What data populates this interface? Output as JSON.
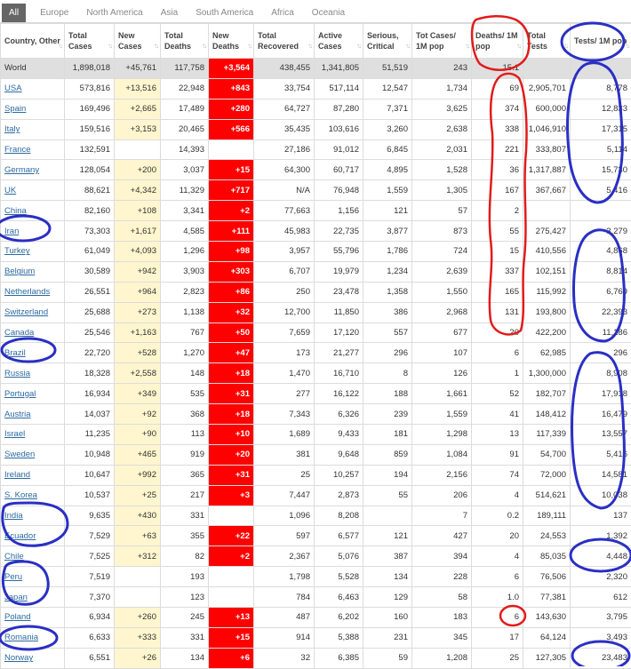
{
  "tabs": [
    "All",
    "Europe",
    "North America",
    "Asia",
    "South America",
    "Africa",
    "Oceania"
  ],
  "headers": [
    "Country, Other",
    "Total Cases",
    "New Cases",
    "Total Deaths",
    "New Deaths",
    "Total Recovered",
    "Active Cases",
    "Serious, Critical",
    "Tot Cases/ 1M pop",
    "Deaths/ 1M pop",
    "Total Tests",
    "Tests/ 1M pop"
  ],
  "world": [
    "World",
    "1,898,018",
    "+45,761",
    "117,758",
    "+3,564",
    "438,455",
    "1,341,805",
    "51,519",
    "243",
    "15.1",
    "",
    ""
  ],
  "rows": [
    [
      "USA",
      "573,816",
      "+13,516",
      "22,948",
      "+843",
      "33,754",
      "517,114",
      "12,547",
      "1,734",
      "69",
      "2,905,701",
      "8,778"
    ],
    [
      "Spain",
      "169,496",
      "+2,665",
      "17,489",
      "+280",
      "64,727",
      "87,280",
      "7,371",
      "3,625",
      "374",
      "600,000",
      "12,833"
    ],
    [
      "Italy",
      "159,516",
      "+3,153",
      "20,465",
      "+566",
      "35,435",
      "103,616",
      "3,260",
      "2,638",
      "338",
      "1,046,910",
      "17,315"
    ],
    [
      "France",
      "132,591",
      "",
      "14,393",
      "",
      "27,186",
      "91,012",
      "6,845",
      "2,031",
      "221",
      "333,807",
      "5,114"
    ],
    [
      "Germany",
      "128,054",
      "+200",
      "3,037",
      "+15",
      "64,300",
      "60,717",
      "4,895",
      "1,528",
      "36",
      "1,317,887",
      "15,730"
    ],
    [
      "UK",
      "88,621",
      "+4,342",
      "11,329",
      "+717",
      "N/A",
      "76,948",
      "1,559",
      "1,305",
      "167",
      "367,667",
      "5,416"
    ],
    [
      "China",
      "82,160",
      "+108",
      "3,341",
      "+2",
      "77,663",
      "1,156",
      "121",
      "57",
      "2",
      "",
      ""
    ],
    [
      "Iran",
      "73,303",
      "+1,617",
      "4,585",
      "+111",
      "45,983",
      "22,735",
      "3,877",
      "873",
      "55",
      "275,427",
      "3,279"
    ],
    [
      "Turkey",
      "61,049",
      "+4,093",
      "1,296",
      "+98",
      "3,957",
      "55,796",
      "1,786",
      "724",
      "15",
      "410,556",
      "4,868"
    ],
    [
      "Belgium",
      "30,589",
      "+942",
      "3,903",
      "+303",
      "6,707",
      "19,979",
      "1,234",
      "2,639",
      "337",
      "102,151",
      "8,814"
    ],
    [
      "Netherlands",
      "26,551",
      "+964",
      "2,823",
      "+86",
      "250",
      "23,478",
      "1,358",
      "1,550",
      "165",
      "115,992",
      "6,769"
    ],
    [
      "Switzerland",
      "25,688",
      "+273",
      "1,138",
      "+32",
      "12,700",
      "11,850",
      "386",
      "2,968",
      "131",
      "193,800",
      "22,393"
    ],
    [
      "Canada",
      "25,546",
      "+1,163",
      "767",
      "+50",
      "7,659",
      "17,120",
      "557",
      "677",
      "20",
      "422,200",
      "11,186"
    ],
    [
      "Brazil",
      "22,720",
      "+528",
      "1,270",
      "+47",
      "173",
      "21,277",
      "296",
      "107",
      "6",
      "62,985",
      "296"
    ],
    [
      "Russia",
      "18,328",
      "+2,558",
      "148",
      "+18",
      "1,470",
      "16,710",
      "8",
      "126",
      "1",
      "1,300,000",
      "8,908"
    ],
    [
      "Portugal",
      "16,934",
      "+349",
      "535",
      "+31",
      "277",
      "16,122",
      "188",
      "1,661",
      "52",
      "182,707",
      "17,918"
    ],
    [
      "Austria",
      "14,037",
      "+92",
      "368",
      "+18",
      "7,343",
      "6,326",
      "239",
      "1,559",
      "41",
      "148,412",
      "16,479"
    ],
    [
      "Israel",
      "11,235",
      "+90",
      "113",
      "+10",
      "1,689",
      "9,433",
      "181",
      "1,298",
      "13",
      "117,339",
      "13,557"
    ],
    [
      "Sweden",
      "10,948",
      "+465",
      "919",
      "+20",
      "381",
      "9,648",
      "859",
      "1,084",
      "91",
      "54,700",
      "5,416"
    ],
    [
      "Ireland",
      "10,647",
      "+992",
      "365",
      "+31",
      "25",
      "10,257",
      "194",
      "2,156",
      "74",
      "72,000",
      "14,581"
    ],
    [
      "S. Korea",
      "10,537",
      "+25",
      "217",
      "+3",
      "7,447",
      "2,873",
      "55",
      "206",
      "4",
      "514,621",
      "10,038"
    ],
    [
      "India",
      "9,635",
      "+430",
      "331",
      "",
      "1,096",
      "8,208",
      "",
      "7",
      "0.2",
      "189,111",
      "137"
    ],
    [
      "Ecuador",
      "7,529",
      "+63",
      "355",
      "+22",
      "597",
      "6,577",
      "121",
      "427",
      "20",
      "24,553",
      "1,392"
    ],
    [
      "Chile",
      "7,525",
      "+312",
      "82",
      "+2",
      "2,367",
      "5,076",
      "387",
      "394",
      "4",
      "85,035",
      "4,448"
    ],
    [
      "Peru",
      "7,519",
      "",
      "193",
      "",
      "1,798",
      "5,528",
      "134",
      "228",
      "6",
      "76,506",
      "2,320"
    ],
    [
      "Japan",
      "7,370",
      "",
      "123",
      "",
      "784",
      "6,463",
      "129",
      "58",
      "1.0",
      "77,381",
      "612"
    ],
    [
      "Poland",
      "6,934",
      "+260",
      "245",
      "+13",
      "487",
      "6,202",
      "160",
      "183",
      "6",
      "143,630",
      "3,795"
    ],
    [
      "Romania",
      "6,633",
      "+333",
      "331",
      "+15",
      "914",
      "5,388",
      "231",
      "345",
      "17",
      "64,124",
      "3,493"
    ],
    [
      "Norway",
      "6,551",
      "+26",
      "134",
      "+6",
      "32",
      "6,385",
      "59",
      "1,208",
      "25",
      "127,305",
      "23,483"
    ]
  ]
}
